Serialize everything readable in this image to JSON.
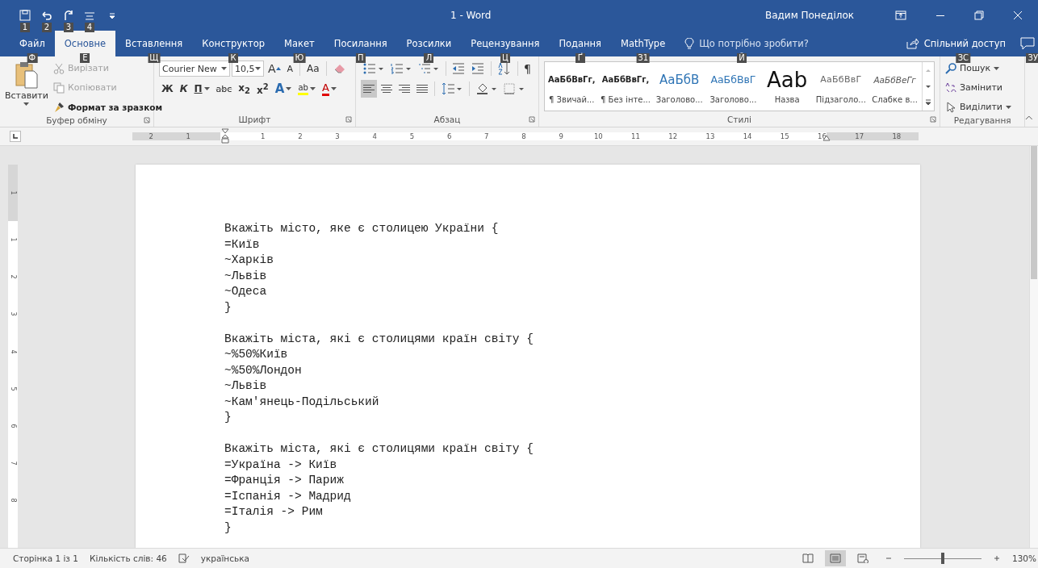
{
  "window": {
    "title": "1 - Word",
    "user": "Вадим Понеділок"
  },
  "quick_access": [
    {
      "kind": "save",
      "keytip": "1"
    },
    {
      "kind": "undo",
      "keytip": "2"
    },
    {
      "kind": "redo",
      "keytip": "3"
    },
    {
      "kind": "touch",
      "keytip": "4"
    }
  ],
  "tabs": [
    {
      "label": "Файл",
      "keytip": "Ф",
      "selected": false
    },
    {
      "label": "Основне",
      "keytip": "Е",
      "selected": true
    },
    {
      "label": "Вставлення",
      "keytip": "Щ",
      "selected": false
    },
    {
      "label": "Конструктор",
      "keytip": "К",
      "selected": false
    },
    {
      "label": "Макет",
      "keytip": "Ю",
      "selected": false
    },
    {
      "label": "Посилання",
      "keytip": "П",
      "selected": false
    },
    {
      "label": "Розсилки",
      "keytip": "Л",
      "selected": false
    },
    {
      "label": "Рецензування",
      "keytip": "Ц",
      "selected": false
    },
    {
      "label": "Подання",
      "keytip": "Ґ",
      "selected": false
    },
    {
      "label": "MathType",
      "keytip": "З1",
      "selected": false
    }
  ],
  "tell_me": {
    "placeholder": "Що потрібно зробити?",
    "keytip": "Й"
  },
  "share": {
    "label": "Спільний доступ",
    "keytip": "ЗС"
  },
  "comments": {
    "keytip": "ЗУ"
  },
  "clipboard": {
    "label": "Буфер обміну",
    "paste": "Вставити",
    "cut": {
      "label": "Вирізати",
      "disabled": true
    },
    "copy": {
      "label": "Копіювати",
      "disabled": true
    },
    "painter": {
      "label": "Формат за зразком",
      "disabled": false
    }
  },
  "font": {
    "label": "Шрифт",
    "family": "Courier New",
    "size": "10,5",
    "grow": "A",
    "shrink": "A",
    "case": "Aa",
    "format": [
      {
        "kind": "bold",
        "label": "Ж"
      },
      {
        "kind": "italic",
        "label": "К"
      },
      {
        "kind": "underline",
        "label": "П"
      },
      {
        "kind": "strike",
        "label": "abc"
      },
      {
        "kind": "sub",
        "label": "x$_{2}$"
      },
      {
        "kind": "sup",
        "label": "x$^{2}$"
      },
      {
        "kind": "effects",
        "label": "A"
      },
      {
        "kind": "highlight",
        "label": "ab"
      },
      {
        "kind": "color",
        "label": "A"
      }
    ]
  },
  "paragraph": {
    "label": "Абзац",
    "pilcrow": "¶",
    "align": [
      {
        "kind": "left",
        "selected": true
      },
      {
        "kind": "center",
        "selected": false
      },
      {
        "kind": "right",
        "selected": false
      },
      {
        "kind": "justify",
        "selected": false
      }
    ]
  },
  "styles": {
    "label": "Стилі",
    "items": [
      {
        "kind": "normal",
        "sample": "АаБбВвГг,",
        "name": "¶ Звичай..."
      },
      {
        "kind": "nospacing",
        "sample": "АаБбВвГг,",
        "name": "¶ Без інте..."
      },
      {
        "kind": "heading1",
        "sample": "АаБбВ",
        "name": "Заголово..."
      },
      {
        "kind": "heading2",
        "sample": "АаБбВвГ",
        "name": "Заголово..."
      },
      {
        "kind": "title",
        "sample": "Aab",
        "name": "Назва"
      },
      {
        "kind": "subtitle",
        "sample": "АаБбВвГ",
        "name": "Підзаголо..."
      },
      {
        "kind": "emphasis",
        "sample": "АаБбВеГг",
        "name": "Слабке в..."
      }
    ]
  },
  "editing": {
    "label": "Редагування",
    "find": "Пошук",
    "replace": "Замінити",
    "select": "Виділити"
  },
  "ruler": {
    "before": [
      "2",
      "1"
    ],
    "marks": [
      "1",
      "2",
      "3",
      "4",
      "5",
      "6",
      "7",
      "8",
      "9",
      "10",
      "11",
      "12",
      "13",
      "14",
      "15",
      "16"
    ],
    "after": [
      "17",
      "18"
    ]
  },
  "vertical_ruler": {
    "before": [
      "1"
    ],
    "marks": [
      "1",
      "2",
      "3",
      "4",
      "5",
      "6",
      "7",
      "8"
    ]
  },
  "document": [
    [
      "Вкажіть місто, яке є столицею України {",
      "=Київ",
      "~Харків",
      "~Львів",
      "~Одеса",
      "}"
    ],
    [
      "Вкажіть міста, які є столицями країн світу {",
      "~%50%Київ",
      "~%50%Лондон",
      "~Львів",
      "~Кам'янець-Подільський",
      "}"
    ],
    [
      "Вкажіть міста, які є столицями країн світу {",
      "=Україна -> Київ",
      "=Франція -> Париж",
      "=Іспанія -> Мадрид",
      "=Італія -> Рим",
      "}"
    ]
  ],
  "status_bar": {
    "page": "Сторінка 1 із 1",
    "words": "Кількість слів: 46",
    "language": "українська",
    "views": [
      {
        "kind": "read",
        "selected": false
      },
      {
        "kind": "print",
        "selected": true
      },
      {
        "kind": "web",
        "selected": false
      }
    ],
    "zoom": {
      "level": 0.5,
      "label": "130%"
    }
  }
}
